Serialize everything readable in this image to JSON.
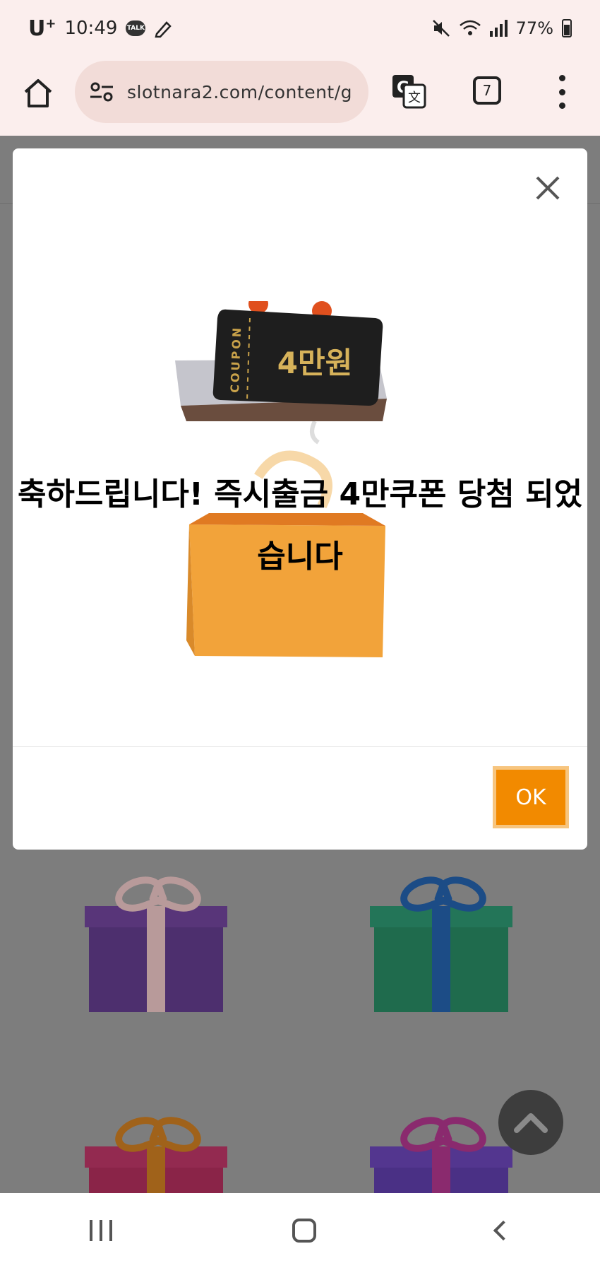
{
  "status_bar": {
    "carrier": "U",
    "carrier_sup": "+",
    "time": "10:49",
    "talk_badge": "TALK",
    "battery": "77%"
  },
  "browser": {
    "url": "slotnara2.com/content/g",
    "tab_count": "7"
  },
  "modal": {
    "coupon_label": "COUPON",
    "coupon_amount": "4만원",
    "message": "축하드립니다! 즉시출금 4만쿠폰 당첨 되었습니다",
    "ok_label": "OK"
  },
  "colors": {
    "ok_button": "#f28a00",
    "backdrop": "#7d7d7d",
    "browser_chrome": "#fbeeed"
  },
  "icons": [
    "home-icon",
    "site-settings-icon",
    "translate-icon",
    "tabs-icon",
    "more-vert-icon",
    "close-icon",
    "chevron-up-icon"
  ]
}
